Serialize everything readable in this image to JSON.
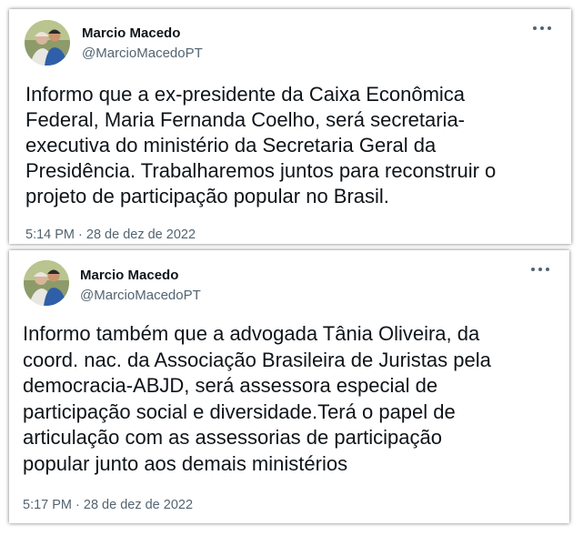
{
  "tweets": [
    {
      "author": {
        "name": "Marcio Macedo",
        "handle": "@MarcioMacedoPT"
      },
      "more_icon": "more-horizontal-icon",
      "text": "Informo que a ex-presidente da Caixa Econômica\nFederal, Maria Fernanda Coelho, será secretaria-\nexecutiva do ministério da Secretaria Geral da\nPresidência. Trabalharemos juntos para reconstruir o\nprojeto de participação popular no Brasil.",
      "time": "5:14 PM",
      "separator": " · ",
      "date": "28 de dez de 2022"
    },
    {
      "author": {
        "name": "Marcio Macedo",
        "handle": "@MarcioMacedoPT"
      },
      "more_icon": "more-horizontal-icon",
      "text": "Informo também que a advogada Tânia Oliveira, da\ncoord. nac. da Associação Brasileira de Juristas pela\ndemocracia-ABJD, será assessora especial de\nparticipação social e diversidade.Terá o papel de\narticulação com as assessorias de participação\npopular junto aos demais ministérios",
      "time": "5:17 PM",
      "separator": " · ",
      "date": "28 de dez de 2022"
    }
  ],
  "colors": {
    "text": "#0f1419",
    "muted": "#536471",
    "background": "#ffffff"
  }
}
